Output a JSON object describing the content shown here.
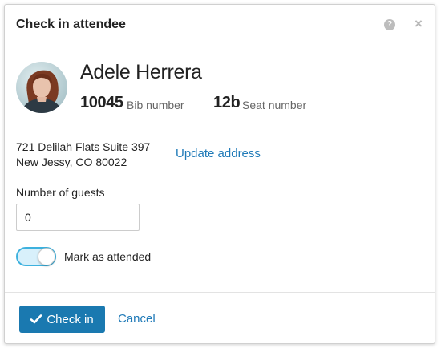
{
  "dialog": {
    "title": "Check in attendee",
    "help_icon": "?",
    "close_icon": "×"
  },
  "attendee": {
    "name": "Adele Herrera",
    "bib_number": "10045",
    "bib_label": "Bib number",
    "seat_number": "12b",
    "seat_label": "Seat number",
    "address_line1": "721 Delilah Flats Suite 397",
    "address_line2": "New Jessy, CO 80022",
    "update_address_label": "Update address"
  },
  "form": {
    "guests_label": "Number of guests",
    "guests_value": "0",
    "attended_label": "Mark as attended",
    "attended_checked": true
  },
  "footer": {
    "check_in_label": "Check in",
    "cancel_label": "Cancel"
  },
  "colors": {
    "accent": "#1a79b0",
    "link": "#1f7ab8",
    "toggle_on_border": "#3db1de",
    "toggle_on_fill": "#d8f0fb"
  },
  "icons": {
    "help": "question-circle-icon",
    "close": "close-icon",
    "check": "check-icon"
  }
}
